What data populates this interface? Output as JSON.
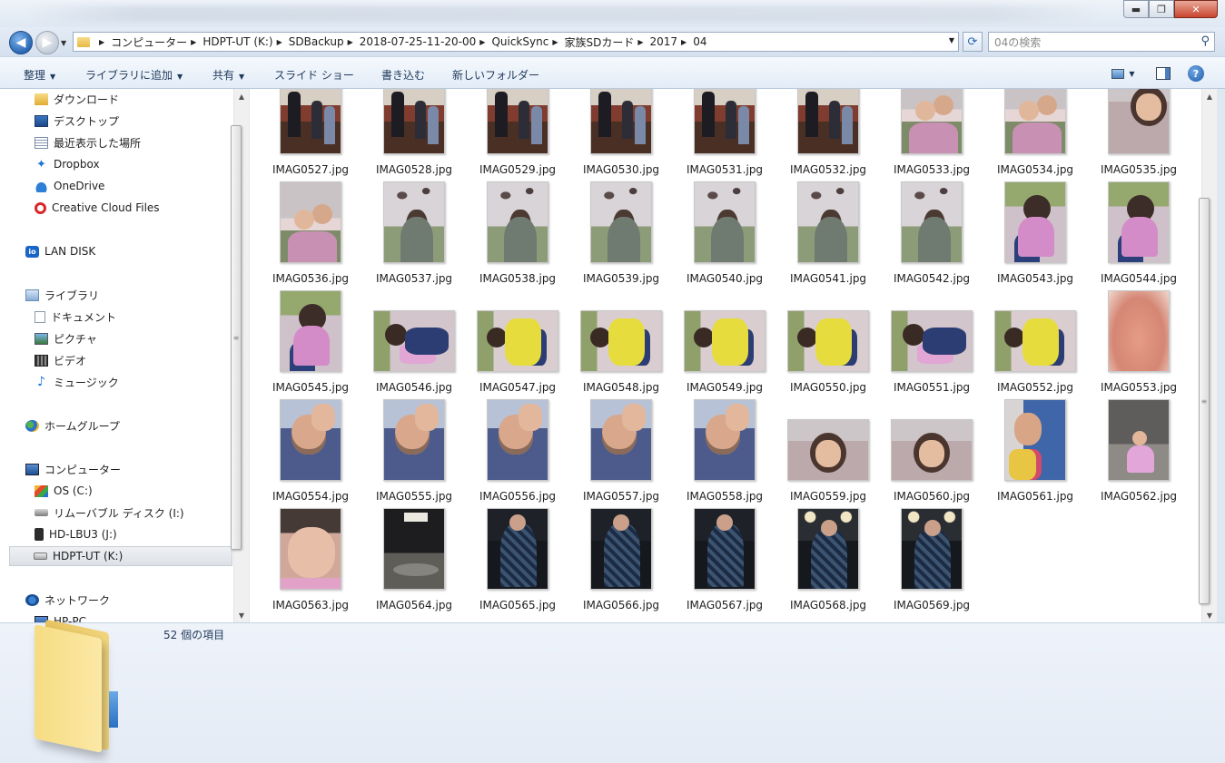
{
  "window": {
    "buttons": {
      "minimize": "▬",
      "maximize": "❐",
      "close": "✕"
    }
  },
  "address": {
    "breadcrumbs": [
      "コンピューター",
      "HDPT-UT (K:)",
      "SDBackup",
      "2018-07-25-11-20-00",
      "QuickSync",
      "家族SDカード",
      "2017",
      "04"
    ],
    "search_placeholder": "04の検索",
    "refresh_glyph": "⟳",
    "search_glyph": "⚲"
  },
  "toolbar": {
    "items": [
      "整理",
      "ライブラリに追加",
      "共有",
      "スライド ショー",
      "書き込む",
      "新しいフォルダー"
    ],
    "help": "?"
  },
  "sidebar": {
    "favorites": [
      "ダウンロード",
      "デスクトップ",
      "最近表示した場所",
      "Dropbox",
      "OneDrive",
      "Creative Cloud Files"
    ],
    "lan_disk": "LAN DISK",
    "libraries": {
      "label": "ライブラリ",
      "items": [
        "ドキュメント",
        "ピクチャ",
        "ビデオ",
        "ミュージック"
      ]
    },
    "homegroup": "ホームグループ",
    "computer": {
      "label": "コンピューター",
      "items": [
        "OS (C:)",
        "リムーバブル ディスク (I:)",
        "HD-LBU3 (J:)",
        "HDPT-UT (K:)"
      ]
    },
    "network": {
      "label": "ネットワーク",
      "items": [
        "HP-PC"
      ]
    }
  },
  "files": [
    "IMAG0527.jpg",
    "IMAG0528.jpg",
    "IMAG0529.jpg",
    "IMAG0530.jpg",
    "IMAG0531.jpg",
    "IMAG0532.jpg",
    "IMAG0533.jpg",
    "IMAG0534.jpg",
    "IMAG0535.jpg",
    "IMAG0536.jpg",
    "IMAG0537.jpg",
    "IMAG0538.jpg",
    "IMAG0539.jpg",
    "IMAG0540.jpg",
    "IMAG0541.jpg",
    "IMAG0542.jpg",
    "IMAG0543.jpg",
    "IMAG0544.jpg",
    "IMAG0545.jpg",
    "IMAG0546.jpg",
    "IMAG0547.jpg",
    "IMAG0548.jpg",
    "IMAG0549.jpg",
    "IMAG0550.jpg",
    "IMAG0551.jpg",
    "IMAG0552.jpg",
    "IMAG0553.jpg",
    "IMAG0554.jpg",
    "IMAG0555.jpg",
    "IMAG0556.jpg",
    "IMAG0557.jpg",
    "IMAG0558.jpg",
    "IMAG0559.jpg",
    "IMAG0560.jpg",
    "IMAG0561.jpg",
    "IMAG0562.jpg",
    "IMAG0563.jpg",
    "IMAG0564.jpg",
    "IMAG0565.jpg",
    "IMAG0566.jpg",
    "IMAG0567.jpg",
    "IMAG0568.jpg",
    "IMAG0569.jpg"
  ],
  "status": {
    "count": "52 個の項目"
  }
}
